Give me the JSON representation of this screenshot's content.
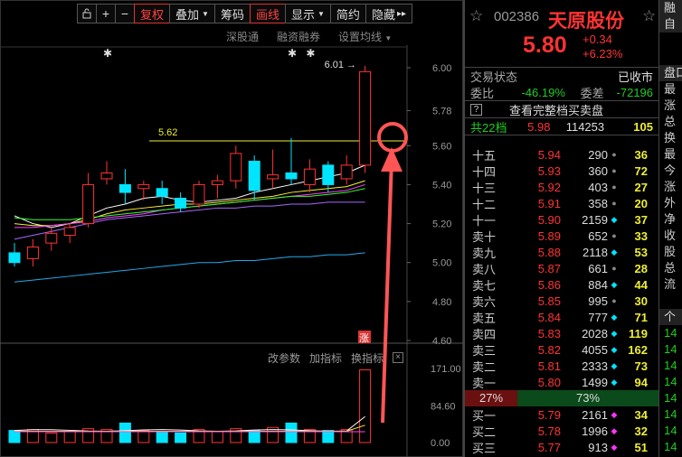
{
  "toolbar": {
    "lock_icon": "lock-icon",
    "plus_label": "+",
    "minus_label": "−",
    "items": [
      "复权",
      "叠加",
      "筹码",
      "画线",
      "显示",
      "简约",
      "隐藏"
    ],
    "active_items": [
      "复权",
      "画线"
    ],
    "expand_label": "▸▸"
  },
  "subbar": [
    "深股通",
    "融资融券",
    "设置均线"
  ],
  "chart": {
    "price_axis": [
      "6.00",
      "5.78",
      "5.60",
      "5.40",
      "5.20",
      "5.00",
      "4.80",
      "4.60"
    ],
    "high_label": "6.01",
    "line_label": "5.62",
    "limit_up_badge": "涨",
    "volume_axis": [
      "171.00",
      "84.60",
      "0.00"
    ],
    "indicator_tabs": [
      "改参数",
      "加指标",
      "换指标"
    ],
    "close_label": "×",
    "colors": {
      "up": "#ff3333",
      "down": "#00e5ff",
      "highlight": "#ff5555",
      "ma5": "#ffffff",
      "ma10": "#ffee33",
      "ma20": "#ff44ff",
      "ma30": "#33ff33",
      "ma60": "#3399ff"
    }
  },
  "chart_data": {
    "type": "candlestick",
    "ylim": [
      4.5,
      6.1
    ],
    "candles": [
      {
        "o": 5.05,
        "h": 5.1,
        "l": 4.98,
        "c": 5.0,
        "up": false
      },
      {
        "o": 5.02,
        "h": 5.12,
        "l": 4.98,
        "c": 5.08,
        "up": true
      },
      {
        "o": 5.1,
        "h": 5.18,
        "l": 5.06,
        "c": 5.15,
        "up": true
      },
      {
        "o": 5.14,
        "h": 5.2,
        "l": 5.1,
        "c": 5.18,
        "up": true
      },
      {
        "o": 5.2,
        "h": 5.46,
        "l": 5.18,
        "c": 5.4,
        "up": true
      },
      {
        "o": 5.43,
        "h": 5.52,
        "l": 5.4,
        "c": 5.46,
        "up": true
      },
      {
        "o": 5.4,
        "h": 5.48,
        "l": 5.3,
        "c": 5.36,
        "up": false
      },
      {
        "o": 5.38,
        "h": 5.42,
        "l": 5.32,
        "c": 5.4,
        "up": true
      },
      {
        "o": 5.38,
        "h": 5.42,
        "l": 5.3,
        "c": 5.34,
        "up": false
      },
      {
        "o": 5.33,
        "h": 5.36,
        "l": 5.26,
        "c": 5.28,
        "up": false
      },
      {
        "o": 5.3,
        "h": 5.42,
        "l": 5.28,
        "c": 5.4,
        "up": true
      },
      {
        "o": 5.4,
        "h": 5.45,
        "l": 5.33,
        "c": 5.42,
        "up": true
      },
      {
        "o": 5.42,
        "h": 5.6,
        "l": 5.38,
        "c": 5.56,
        "up": true
      },
      {
        "o": 5.52,
        "h": 5.55,
        "l": 5.32,
        "c": 5.37,
        "up": false
      },
      {
        "o": 5.43,
        "h": 5.58,
        "l": 5.38,
        "c": 5.45,
        "up": true
      },
      {
        "o": 5.46,
        "h": 5.64,
        "l": 5.4,
        "c": 5.43,
        "up": false
      },
      {
        "o": 5.4,
        "h": 5.53,
        "l": 5.36,
        "c": 5.48,
        "up": true
      },
      {
        "o": 5.5,
        "h": 5.52,
        "l": 5.36,
        "c": 5.4,
        "up": false
      },
      {
        "o": 5.43,
        "h": 5.55,
        "l": 5.4,
        "c": 5.5,
        "up": true
      },
      {
        "o": 5.5,
        "h": 6.01,
        "l": 5.46,
        "c": 5.98,
        "up": true
      }
    ],
    "volumes": [
      28,
      30,
      22,
      26,
      32,
      30,
      45,
      28,
      25,
      22,
      30,
      26,
      32,
      28,
      35,
      45,
      30,
      28,
      30,
      168
    ],
    "ma_lines": {
      "ma_white": [
        5.24,
        5.2,
        5.18,
        5.2,
        5.24,
        5.28,
        5.3,
        5.33,
        5.34,
        5.32,
        5.31,
        5.32,
        5.33,
        5.36,
        5.38,
        5.4,
        5.42,
        5.44,
        5.46,
        5.5
      ],
      "ma_yellow": [
        5.2,
        5.19,
        5.19,
        5.2,
        5.22,
        5.25,
        5.27,
        5.28,
        5.29,
        5.3,
        5.3,
        5.31,
        5.32,
        5.33,
        5.34,
        5.36,
        5.37,
        5.38,
        5.39,
        5.42
      ],
      "ma_magenta": [
        5.18,
        5.18,
        5.19,
        5.2,
        5.21,
        5.23,
        5.24,
        5.25,
        5.27,
        5.28,
        5.29,
        5.3,
        5.31,
        5.32,
        5.33,
        5.34,
        5.35,
        5.36,
        5.37,
        5.4
      ],
      "ma_green": [
        5.23,
        5.22,
        5.22,
        5.22,
        5.23,
        5.24,
        5.25,
        5.26,
        5.27,
        5.28,
        5.29,
        5.3,
        5.31,
        5.32,
        5.33,
        5.34,
        5.34,
        5.35,
        5.36,
        5.38
      ],
      "ma_blue": [
        4.9,
        4.91,
        4.92,
        4.93,
        4.94,
        4.95,
        4.96,
        4.97,
        4.98,
        4.99,
        5.0,
        5.0,
        5.01,
        5.01,
        5.02,
        5.03,
        5.03,
        5.04,
        5.04,
        5.05
      ],
      "ma_purple": [
        5.12,
        5.14,
        5.16,
        5.18,
        5.2,
        5.22,
        5.23,
        5.24,
        5.25,
        5.26,
        5.27,
        5.28,
        5.28,
        5.29,
        5.29,
        5.3,
        5.3,
        5.31,
        5.31,
        5.31
      ]
    },
    "horizontal_line": 5.62,
    "volume_ylim": [
      0,
      171
    ]
  },
  "quote": {
    "star_icon": "star-icon",
    "code": "002386",
    "name": "天原股份",
    "price": "5.80",
    "change": "+0.34",
    "change_pct": "+6.23%",
    "status_label": "交易状态",
    "status_value": "已收市",
    "ratio_label": "委比",
    "ratio_value": "-46.19%",
    "diff_label": "委差",
    "diff_value": "-72196",
    "full_book_label": "查看完整档买卖盘",
    "total_label": "共22档",
    "total_price": "5.98",
    "total_vol": "114253",
    "total_cnt": "105",
    "asks": [
      {
        "label": "十五",
        "price": "5.94",
        "vol": "290",
        "dot": "grey",
        "cnt": "36"
      },
      {
        "label": "十四",
        "price": "5.93",
        "vol": "360",
        "dot": "grey",
        "cnt": "72"
      },
      {
        "label": "十三",
        "price": "5.92",
        "vol": "403",
        "dot": "grey",
        "cnt": "27"
      },
      {
        "label": "十二",
        "price": "5.91",
        "vol": "358",
        "dot": "grey",
        "cnt": "20"
      },
      {
        "label": "十一",
        "price": "5.90",
        "vol": "2159",
        "dot": "cyan",
        "cnt": "37"
      },
      {
        "label": "卖十",
        "price": "5.89",
        "vol": "652",
        "dot": "grey",
        "cnt": "33"
      },
      {
        "label": "卖九",
        "price": "5.88",
        "vol": "2118",
        "dot": "cyan",
        "cnt": "53"
      },
      {
        "label": "卖八",
        "price": "5.87",
        "vol": "661",
        "dot": "grey",
        "cnt": "28"
      },
      {
        "label": "卖七",
        "price": "5.86",
        "vol": "884",
        "dot": "cyan",
        "cnt": "44"
      },
      {
        "label": "卖六",
        "price": "5.85",
        "vol": "995",
        "dot": "grey",
        "cnt": "30"
      },
      {
        "label": "卖五",
        "price": "5.84",
        "vol": "777",
        "dot": "cyan",
        "cnt": "71"
      },
      {
        "label": "卖四",
        "price": "5.83",
        "vol": "2028",
        "dot": "cyan",
        "cnt": "119"
      },
      {
        "label": "卖三",
        "price": "5.82",
        "vol": "4055",
        "dot": "cyan",
        "cnt": "162"
      },
      {
        "label": "卖二",
        "price": "5.81",
        "vol": "2333",
        "dot": "cyan",
        "cnt": "73"
      },
      {
        "label": "卖一",
        "price": "5.80",
        "vol": "1499",
        "dot": "cyan",
        "cnt": "94"
      }
    ],
    "pct_left": "27%",
    "pct_right": "73%",
    "bids": [
      {
        "label": "买一",
        "price": "5.79",
        "vol": "2161",
        "dot": "magenta",
        "cnt": "34"
      },
      {
        "label": "买二",
        "price": "5.78",
        "vol": "1996",
        "dot": "magenta",
        "cnt": "32"
      },
      {
        "label": "买三",
        "price": "5.77",
        "vol": "913",
        "dot": "magenta",
        "cnt": "51"
      }
    ]
  },
  "side": {
    "rows": [
      "融",
      "自",
      "",
      "",
      "盘口",
      "最",
      "涨",
      "总",
      "换",
      "最",
      "今",
      "涨",
      "外",
      "净",
      "收",
      "股",
      "总",
      "流",
      "",
      "个",
      "14",
      "14",
      "14",
      "14",
      "14",
      "14",
      "14",
      "14",
      "14"
    ]
  }
}
